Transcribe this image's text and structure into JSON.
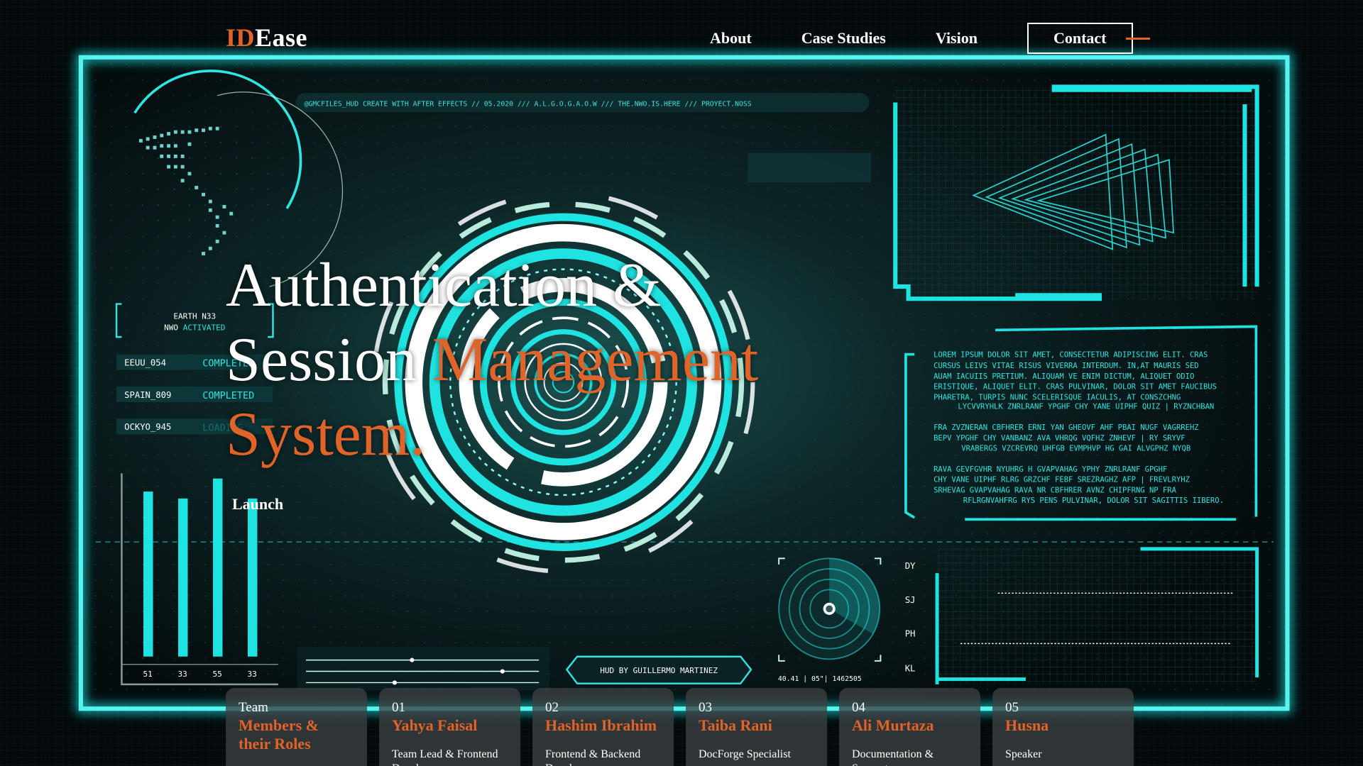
{
  "brand": {
    "logo_accent": "ID",
    "logo_rest": "Ease",
    "accent_color": "#e0632a",
    "hud_color": "#1fe3e0"
  },
  "nav": {
    "links": [
      "About",
      "Case Studies",
      "Vision",
      "Contact"
    ]
  },
  "hero": {
    "title_line1": "Authentication &",
    "title_line2a": "Session ",
    "title_line2b": "Management",
    "title_line3": "System.",
    "launch_label": "Launch"
  },
  "team": {
    "header_num": "Team",
    "header_title": "Members & their Roles",
    "members": [
      {
        "num": "01",
        "name": "Yahya Faisal",
        "role": "Team Lead & Frontend Developer"
      },
      {
        "num": "02",
        "name": "Hashim Ibrahim",
        "role": "Frontend & Backend Developer"
      },
      {
        "num": "03",
        "name": "Taiba Rani",
        "role": "DocForge Specialist"
      },
      {
        "num": "04",
        "name": "Ali Murtaza",
        "role": "Documentation & Support"
      },
      {
        "num": "05",
        "name": "Husna",
        "role": "Speaker"
      }
    ]
  },
  "hud": {
    "top_banner": "@GMCFILES_HUD CREATE WITH AFTER EFFECTS // 05.2020 /// A.L.G.O.G.A.O.W /// THE.NWO.IS.HERE /// PROYECT.NOSS",
    "earth_line1": "EARTH N33",
    "earth_line2a": "NWO ",
    "earth_line2b": "ACTIVATED",
    "status_rows": [
      {
        "code": "EEUU_054",
        "status": "COMPLETED"
      },
      {
        "code": "SPAIN_809",
        "status": "COMPLETED"
      },
      {
        "code": "OCKYO_945",
        "status": "LOADING"
      }
    ],
    "bar_labels": [
      "51",
      "33",
      "55",
      "33"
    ],
    "credit": "HUD BY GUILLERMO MARTINEZ",
    "coords": "40.41 | 05\"| 1462505",
    "radar_labels": [
      "DY",
      "SJ",
      "PH",
      "KL"
    ],
    "text_block": [
      "LOREM IPSUM DOLOR SIT AMET, CONSECTETUR ADIPISCING ELIT. CRAS",
      "CURSUS LEIVS VITAE RISUS VIVERRA INTERDUM. IN,AT MAURIS SED",
      "AUAM IACUIIS PRETIUM. ALIQUAM VE ENIM DICTUM, ALIQUET ODIO",
      "ERISTIQUE, ALIQUET ELIT. CRAS PULVINAR, DOLOR SIT AMET FAUCIBUS",
      "PHARETRA, TURPIS NUNC SCELERISQUE IACULIS, AT CONSZCHNG",
      "LYCVVRYHLK ZNRLRANF YPGHF CHY YANE UIPHF QUIZ | RYZNCHBAN",
      "",
      "FRA ZVZNERAN CBFHRER ERNI YAN GHEOVF AHF PBAI NUGF VAGRREHZ",
      "BEPV YPGHF CHY VANBANZ AVA VHRQG VQFHZ ZNHEVF | RY SRYVF",
      "VRABERGS VZCREVRQ UHFGB EVMPHVP HG GAI ALVGPHZ NYQB",
      "",
      "RAVA GEVFGVHR NYUHRG H GVAPVAHAG YPHY ZNRLRANF GPGHF",
      "CHY VANE UIPHF RLRG GRZCHF FEBF SREZRAGHZ AFP | FREVLRYHZ",
      "SRHEVAG GVAPVAHAG RAVA NR CBFHRER AVNZ CHIPFRNG NP FRA",
      "RFLRGNVAHFRG RYS PENS PULVINAR, DOLOR SIT SAGITTIS IIBERO."
    ]
  }
}
